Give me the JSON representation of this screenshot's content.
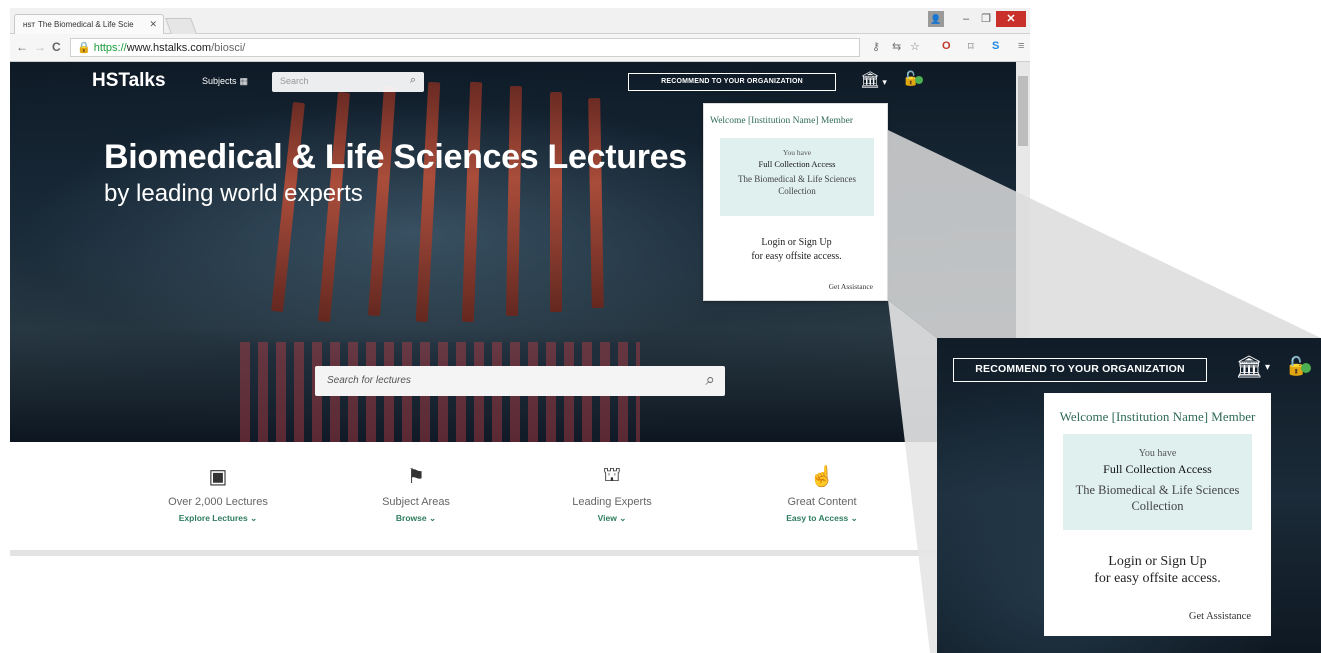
{
  "browser": {
    "tab_title": "The Biomedical & Life Scie",
    "tab_favicon": "HST",
    "url_secure": "https://",
    "url_host": "www.hstalks.com",
    "url_path": "/biosci/"
  },
  "header": {
    "logo": "HSTalks",
    "subjects_label": "Subjects",
    "search_placeholder": "Search",
    "recommend_label": "RECOMMEND TO YOUR ORGANIZATION"
  },
  "hero": {
    "title": "Biomedical & Life Sciences Lectures",
    "subtitle": "by leading world experts",
    "search_placeholder": "Search for lectures"
  },
  "popup": {
    "welcome": "Welcome [Institution Name] Member",
    "you_have": "You have",
    "access_level": "Full Collection Access",
    "collection": "The Biomedical & Life Sciences Collection",
    "login_line1": "Login or Sign Up",
    "login_line2": "for easy offsite access.",
    "assistance": "Get Assistance"
  },
  "features": [
    {
      "icon": "lecture-screen-icon",
      "title": "Over 2,000 Lectures",
      "action": "Explore Lectures"
    },
    {
      "icon": "flag-icon",
      "title": "Subject Areas",
      "action": "Browse"
    },
    {
      "icon": "podium-icon",
      "title": "Leading Experts",
      "action": "View"
    },
    {
      "icon": "pointer-hand-icon",
      "title": "Great Content",
      "action": "Easy to Access"
    }
  ],
  "colors": {
    "accent_green": "#2e7d5e",
    "popup_box": "#dff0ee",
    "close_red": "#c9302c"
  }
}
